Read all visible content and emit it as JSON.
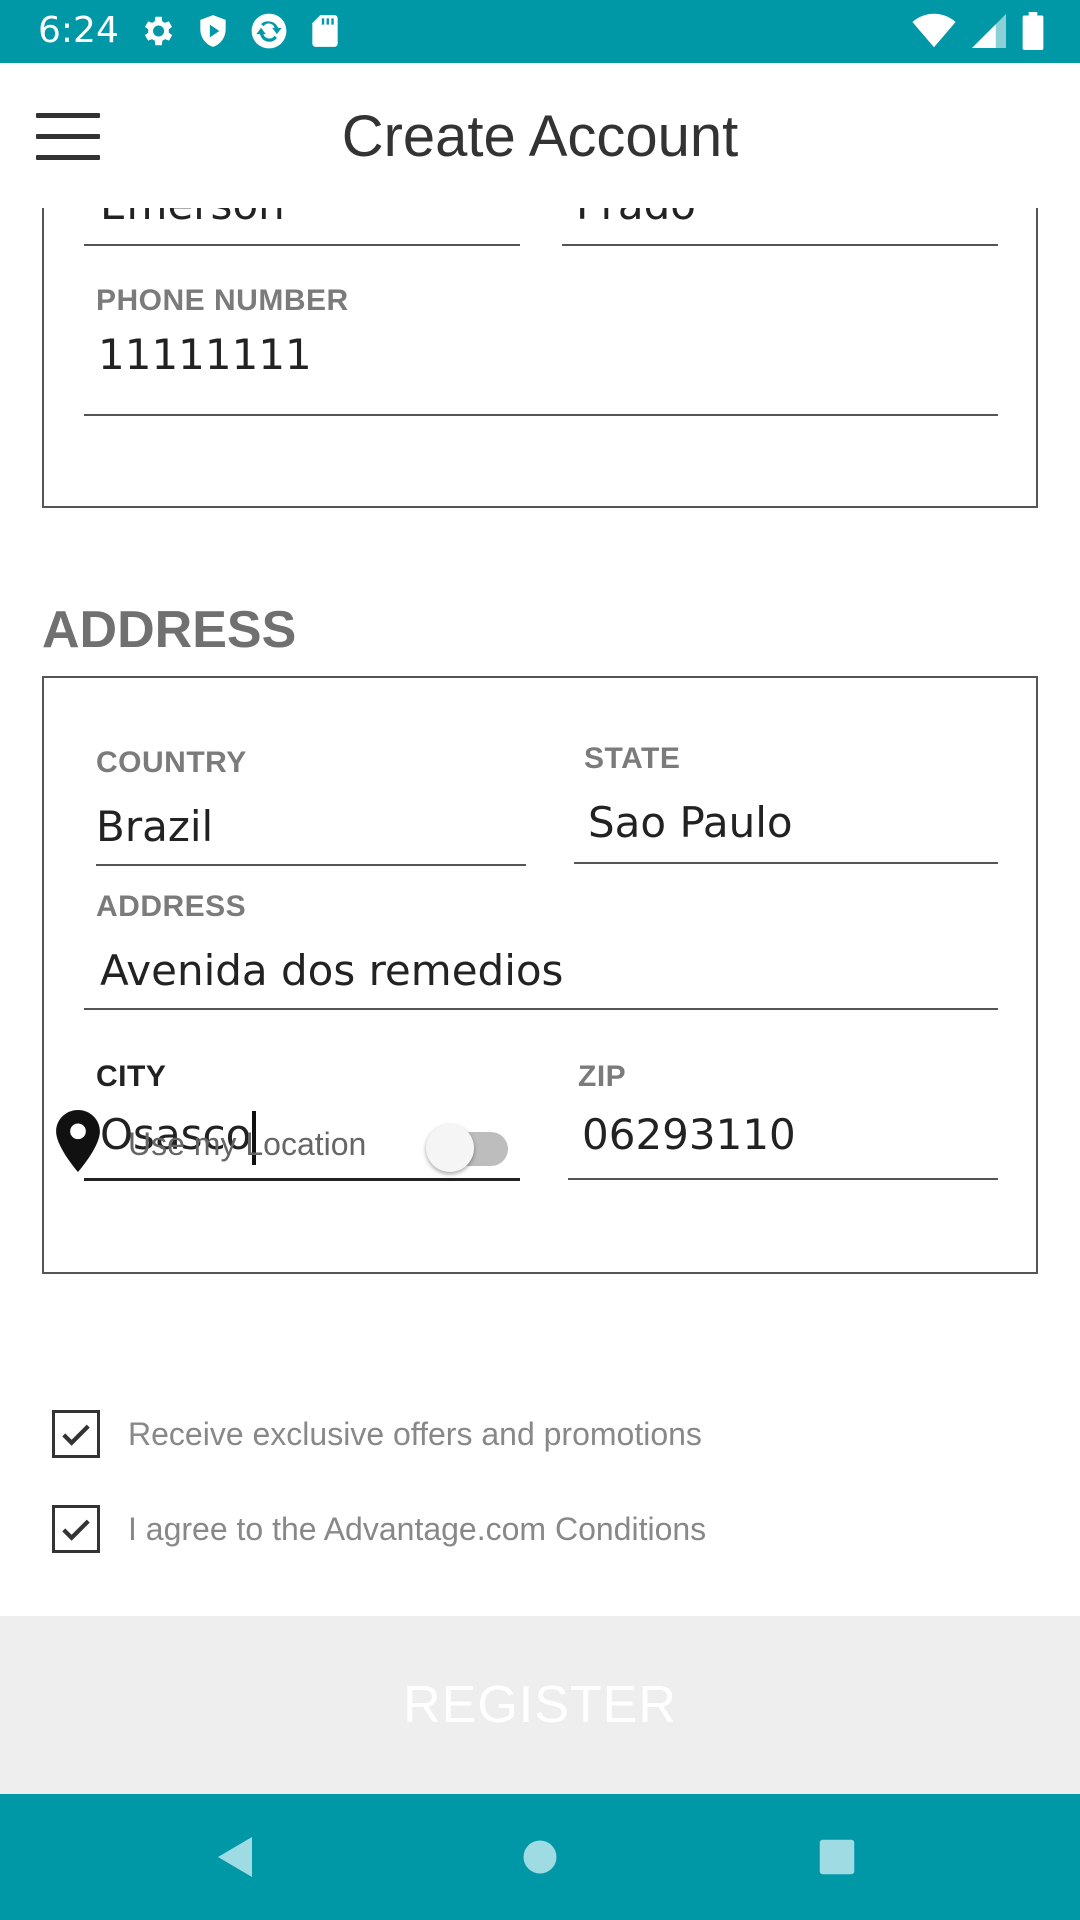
{
  "status_bar": {
    "time": "6:24",
    "icons_left": [
      "gear-icon",
      "shield-icon",
      "sync-icon",
      "sd-card-icon"
    ],
    "icons_right": [
      "wifi-icon",
      "signal-icon",
      "battery-icon"
    ],
    "color": "#0097a7"
  },
  "app_bar": {
    "title": "Create Account",
    "menu_icon": "hamburger-menu-icon"
  },
  "account_details": {
    "first_name_value": "Emerson",
    "last_name_value": "Prado",
    "phone_label": "PHONE NUMBER",
    "phone_value": "11111111"
  },
  "address_section": {
    "title": "ADDRESS",
    "country_label": "COUNTRY",
    "country_value": "Brazil",
    "state_label": "STATE",
    "state_value": "Sao Paulo",
    "address_label": "ADDRESS",
    "address_value": "Avenida dos remedios",
    "city_label": "CITY",
    "city_value": "Osasco",
    "zip_label": "ZIP",
    "zip_value": "06293110"
  },
  "options": {
    "location_label": "Use my Location",
    "location_enabled": false,
    "offers_label": "Receive exclusive offers and promotions",
    "offers_checked": true,
    "conditions_label": "I agree to the Advantage.com Conditions",
    "conditions_checked": true
  },
  "register": {
    "label": "REGISTER"
  },
  "nav_bar": {
    "buttons": [
      "back-icon",
      "home-icon",
      "recents-icon"
    ]
  }
}
